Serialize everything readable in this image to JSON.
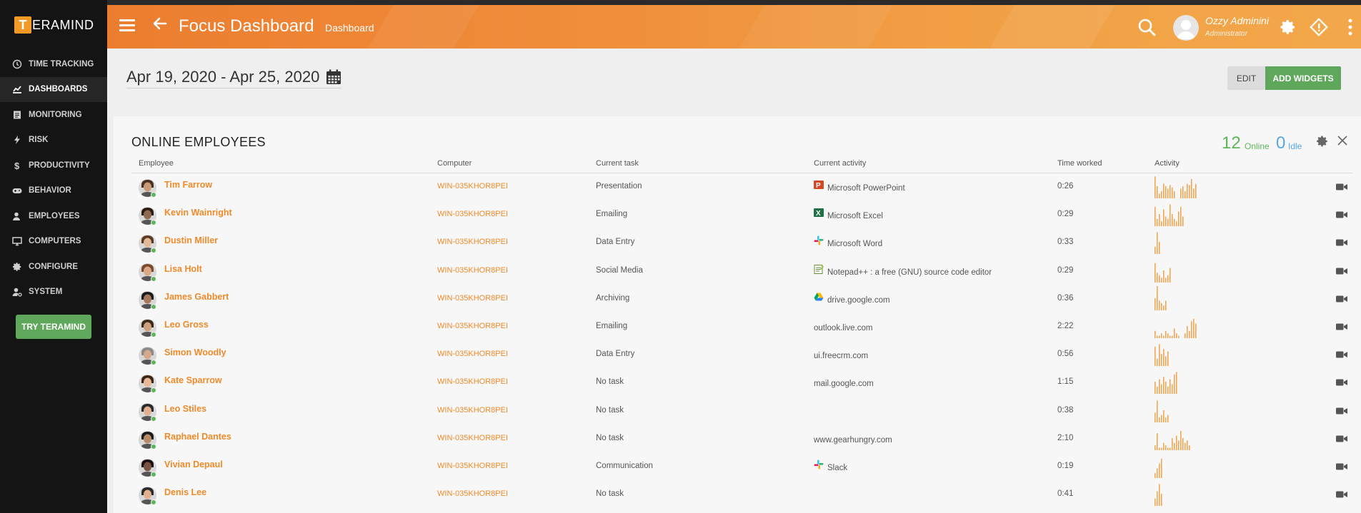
{
  "brand": {
    "logo_letter": "T",
    "logo_rest": "ERAMIND"
  },
  "sidebar": {
    "items": [
      {
        "label": "TIME TRACKING",
        "icon": "clock-icon"
      },
      {
        "label": "DASHBOARDS",
        "icon": "chart-icon",
        "active": true
      },
      {
        "label": "MONITORING",
        "icon": "monitoring-icon"
      },
      {
        "label": "RISK",
        "icon": "bolt-icon"
      },
      {
        "label": "PRODUCTIVITY",
        "icon": "dollar-icon"
      },
      {
        "label": "BEHAVIOR",
        "icon": "gamepad-icon"
      },
      {
        "label": "EMPLOYEES",
        "icon": "users-icon"
      },
      {
        "label": "COMPUTERS",
        "icon": "desktop-icon"
      },
      {
        "label": "CONFIGURE",
        "icon": "gear-icon"
      },
      {
        "label": "SYSTEM",
        "icon": "user-gear-icon"
      }
    ],
    "try_button": "TRY TERAMIND"
  },
  "header": {
    "title": "Focus Dashboard",
    "breadcrumb": "Dashboard",
    "user_name": "Ozzy Adminini",
    "user_role": "Administrator"
  },
  "toolbar": {
    "date_range": "Apr 19, 2020 - Apr 25, 2020",
    "edit_label": "EDIT",
    "add_widgets_label": "ADD WIDGETS"
  },
  "panel": {
    "title": "ONLINE EMPLOYEES",
    "online_count": "12",
    "online_label": "Online",
    "idle_count": "0",
    "idle_label": "Idle",
    "columns": [
      "Employee",
      "Computer",
      "Current task",
      "Current activity",
      "Time worked",
      "Activity"
    ],
    "rows": [
      {
        "name": "Tim Farrow",
        "computer": "WIN-035KHOR8PEI",
        "task": "Presentation",
        "activity": "Microsoft PowerPoint",
        "activity_icon": "powerpoint-icon",
        "time": "0:26",
        "status": "online",
        "skin": "#c99a78",
        "hair": "#4a3020",
        "spark": [
          0.9,
          0.5,
          0.2,
          0.3,
          0.6,
          0.5,
          0.4,
          0.55,
          0.45,
          0.3,
          0,
          0,
          0.4,
          0.5,
          0.3,
          0.6,
          0.55,
          0.8,
          0.4,
          0.6
        ]
      },
      {
        "name": "Kevin Wainright",
        "computer": "WIN-035KHOR8PEI",
        "task": "Emailing",
        "activity": "Microsoft Excel",
        "activity_icon": "excel-icon",
        "time": "0:29",
        "status": "online",
        "skin": "#8f6a52",
        "hair": "#2a1a12",
        "spark": [
          0.8,
          0.3,
          0.5,
          0.2,
          0.7,
          0.4,
          0.3,
          0.9,
          0.5,
          0.3,
          0.2,
          0.6,
          0.8,
          0.4
        ]
      },
      {
        "name": "Dustin Miller",
        "computer": "WIN-035KHOR8PEI",
        "task": "Data Entry",
        "activity": "Microsoft Word",
        "activity_icon": "slack-icon",
        "time": "0:33",
        "status": "online",
        "skin": "#e0b89a",
        "hair": "#5a3a22",
        "spark": [
          0.3,
          0.9,
          0.5
        ]
      },
      {
        "name": "Lisa Holt",
        "computer": "WIN-035KHOR8PEI",
        "task": "Social Media",
        "activity": "Notepad++ : a free (GNU) source code editor",
        "activity_icon": "notepad-icon",
        "time": "0:29",
        "status": "online",
        "skin": "#d8a888",
        "hair": "#7a4a2a",
        "spark": [
          0.8,
          0.4,
          0.3,
          0.2,
          0.5,
          0.2,
          0.3,
          0.6
        ]
      },
      {
        "name": "James Gabbert",
        "computer": "WIN-035KHOR8PEI",
        "task": "Archiving",
        "activity": "drive.google.com",
        "activity_icon": "gdrive-icon",
        "time": "0:36",
        "status": "online",
        "skin": "#a57a5a",
        "hair": "#1a1a1a",
        "spark": [
          0.5,
          1,
          0.4,
          0.3,
          0.2,
          0.4
        ]
      },
      {
        "name": "Leo Gross",
        "computer": "WIN-035KHOR8PEI",
        "task": "Emailing",
        "activity": "outlook.live.com",
        "activity_icon": "",
        "time": "2:22",
        "status": "online",
        "skin": "#cfa080",
        "hair": "#3a2a1a",
        "spark": [
          0.3,
          0.1,
          0.1,
          0.2,
          0.1,
          0.3,
          0.2,
          0.1,
          0.1,
          0.4,
          0.2,
          0.1,
          0,
          0,
          0.2,
          0.5,
          0.3,
          0.7,
          0.8,
          0.6
        ]
      },
      {
        "name": "Simon Woodly",
        "computer": "WIN-035KHOR8PEI",
        "task": "Data Entry",
        "activity": "ui.freecrm.com",
        "activity_icon": "",
        "time": "0:56",
        "status": "online",
        "skin": "#d6a98a",
        "hair": "#8a8a8a",
        "spark": [
          0.8,
          0.3,
          0.9,
          0.5,
          0.7,
          0.4,
          0.6
        ]
      },
      {
        "name": "Kate Sparrow",
        "computer": "WIN-035KHOR8PEI",
        "task": "No task",
        "activity": "mail.google.com",
        "activity_icon": "",
        "time": "1:15",
        "status": "online",
        "skin": "#e6b898",
        "hair": "#3a2412",
        "spark": [
          0.5,
          0.3,
          0.6,
          0.4,
          0.7,
          0.5,
          0.3,
          0.6,
          0.4,
          0.8,
          0.9
        ]
      },
      {
        "name": "Leo Stiles",
        "computer": "WIN-035KHOR8PEI",
        "task": "No task",
        "activity": "",
        "activity_icon": "",
        "time": "0:38",
        "status": "online",
        "skin": "#e0b090",
        "hair": "#2a2a2a",
        "spark": [
          0.4,
          0.9,
          0.2,
          0.3,
          0.5,
          0.2,
          0.3
        ]
      },
      {
        "name": "Raphael Dantes",
        "computer": "WIN-035KHOR8PEI",
        "task": "No task",
        "activity": "www.gearhungry.com",
        "activity_icon": "",
        "time": "2:10",
        "status": "online",
        "skin": "#b88a68",
        "hair": "#1a1a1a",
        "spark": [
          0.2,
          0.7,
          0.1,
          0.1,
          0.3,
          0.2,
          0.1,
          0.1,
          0.5,
          0.3,
          0.6,
          0.4,
          0.8,
          0.5,
          0.3,
          0.4,
          0.2
        ]
      },
      {
        "name": "Vivian Depaul",
        "computer": "WIN-035KHOR8PEI",
        "task": "Communication",
        "activity": "Slack",
        "activity_icon": "slack-icon",
        "time": "0:19",
        "status": "online",
        "skin": "#7a5440",
        "hair": "#1a1010",
        "spark": [
          0.2,
          0.4,
          0.6,
          0.8
        ]
      },
      {
        "name": "Denis Lee",
        "computer": "WIN-035KHOR8PEI",
        "task": "No task",
        "activity": "",
        "activity_icon": "",
        "time": "0:41",
        "status": "online",
        "skin": "#e0b090",
        "hair": "#2a2a2a",
        "spark": [
          0.3,
          0.6,
          0.9,
          0.5
        ]
      }
    ]
  },
  "colors": {
    "accent": "#ef8a2a",
    "online": "#5fb55b",
    "idle": "#5aa7e6",
    "green_button": "#5fa85b"
  }
}
